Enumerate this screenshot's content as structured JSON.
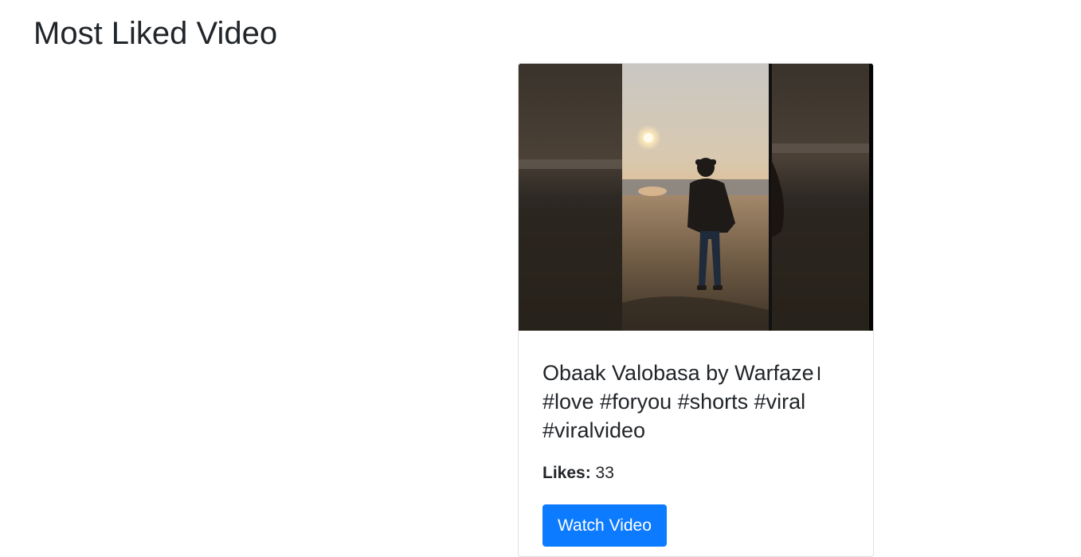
{
  "page": {
    "title": "Most Liked Video"
  },
  "video_card": {
    "thumbnail_alt": "person-silhouette-at-beach-sunset-image",
    "title": "Obaak Valobasa by Warfaze। #love #foryou #shorts #viral #viralvideo",
    "likes_label": "Likes:",
    "likes_value": "33",
    "watch_button_label": "Watch Video"
  },
  "colors": {
    "button_bg": "#0d7bff",
    "text": "#212529",
    "card_border": "#dfdfdf"
  }
}
